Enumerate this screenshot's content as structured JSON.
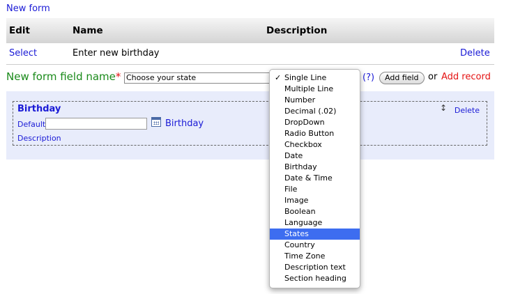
{
  "top": {
    "new_form": "New form"
  },
  "table": {
    "headers": {
      "edit": "Edit",
      "name": "Name",
      "description": "Description"
    },
    "row": {
      "select": "Select",
      "name": "Enter new birthday",
      "delete": "Delete"
    }
  },
  "field_row": {
    "label": "New form field name",
    "required_mark": "*",
    "input_value": "Choose your state",
    "help": "(?)",
    "add_field": "Add field",
    "or": "or",
    "add_record": "Add record"
  },
  "field_panel": {
    "title": "Birthday",
    "delete": "Delete",
    "resize_glyph": "↕",
    "default_label": "Default",
    "default_value": "",
    "field_label": "Birthday",
    "description_label": "Description"
  },
  "dropdown": {
    "check_glyph": "✓",
    "selected": "States",
    "items": [
      "Single Line",
      "Multiple Line",
      "Number",
      "Decimal (.02)",
      "DropDown",
      "Radio Button",
      "Checkbox",
      "Date",
      "Birthday",
      "Date & Time",
      "File",
      "Image",
      "Boolean",
      "Language",
      "States",
      "Country",
      "Time Zone",
      "Description text",
      "Section heading"
    ]
  },
  "colors": {
    "link": "#1a1ad6",
    "label_green": "#1a8a1a",
    "required_red": "#e41111",
    "panel_bg": "#e8ecfb",
    "highlight": "#3d6df0"
  }
}
